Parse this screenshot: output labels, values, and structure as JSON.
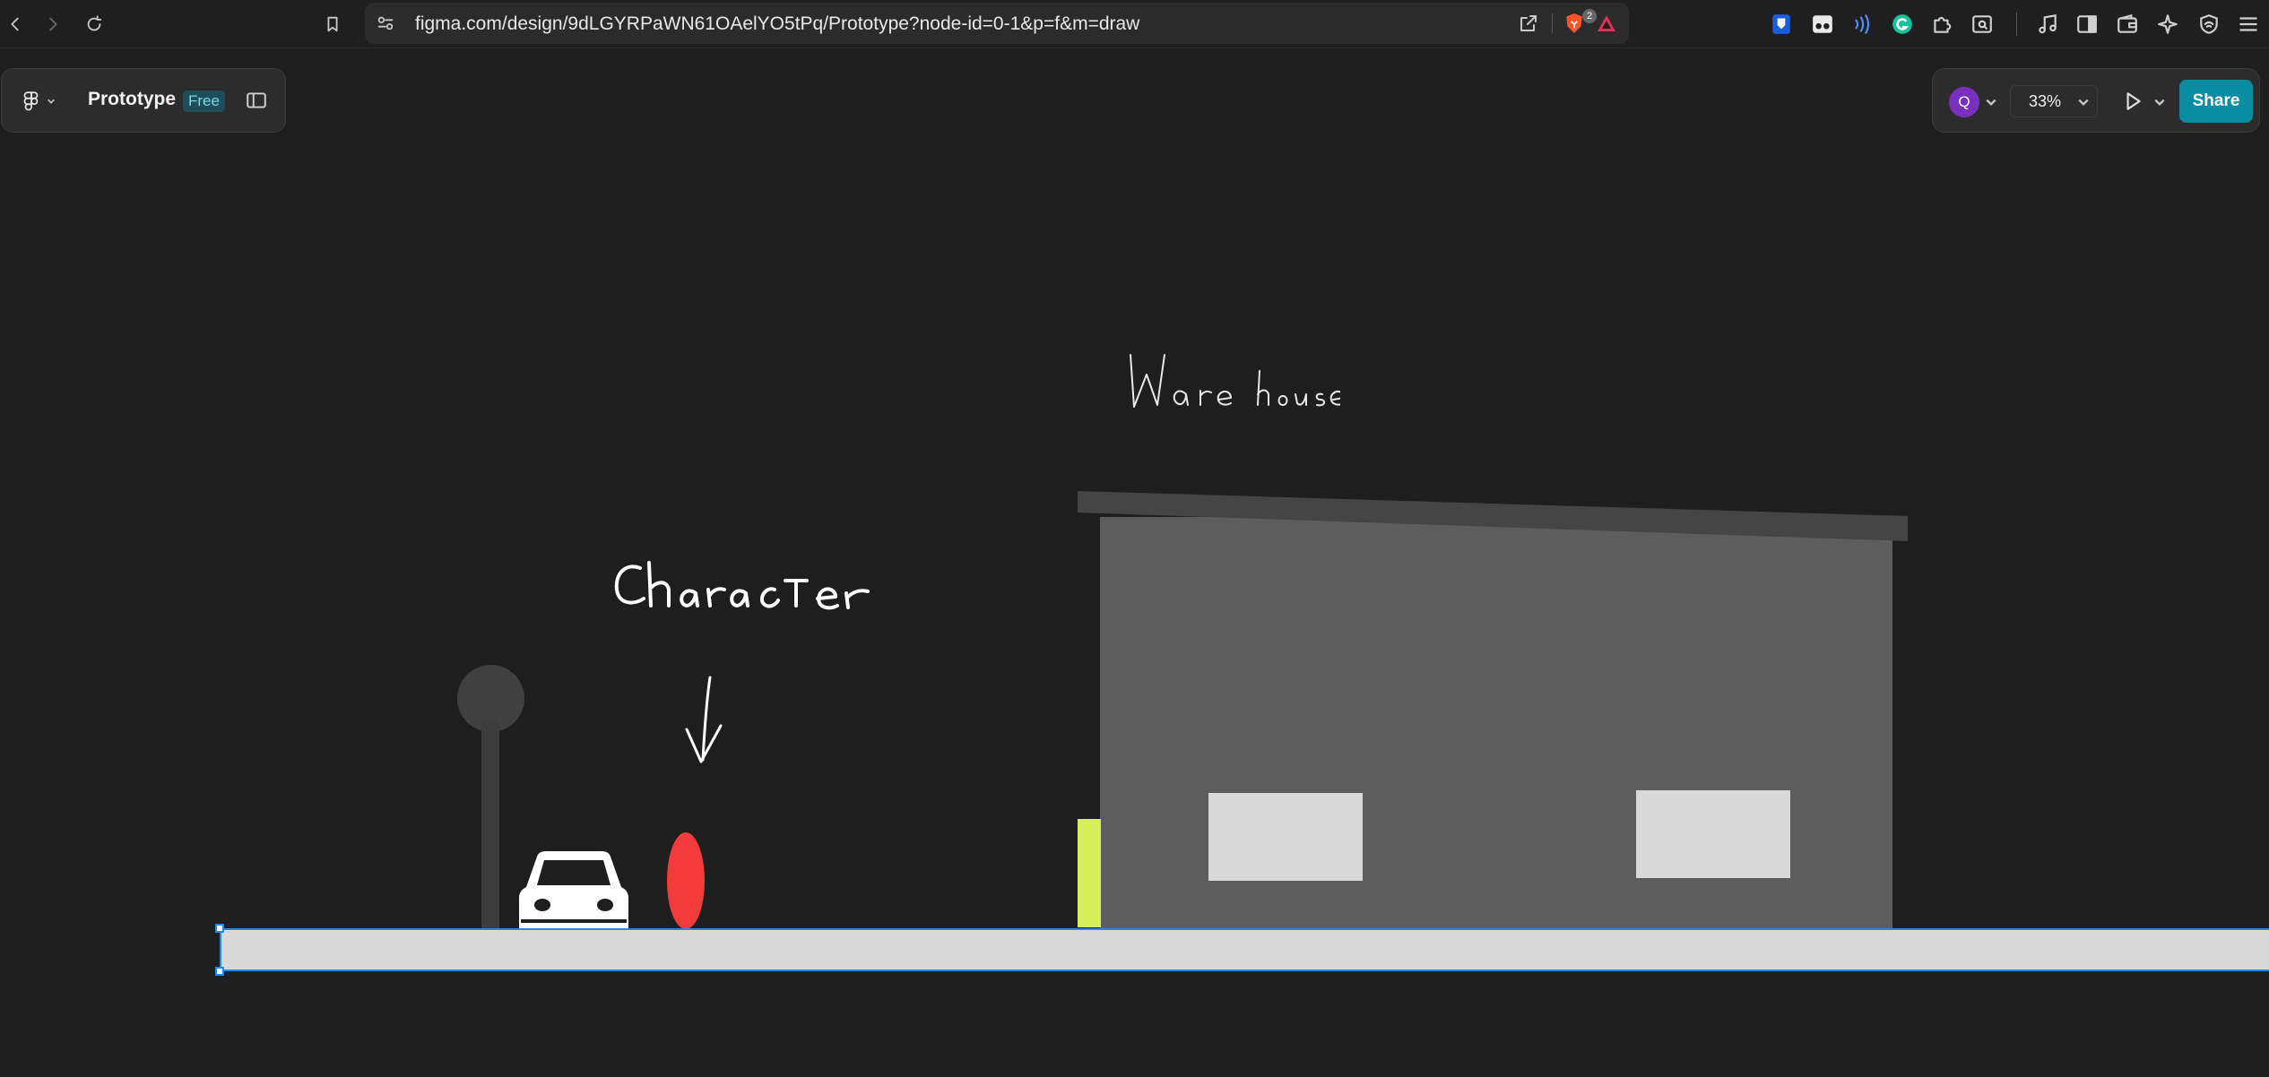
{
  "browser": {
    "url": "figma.com/design/9dLGYRPaWN61OAelYO5tPq/Prototype?node-id=0-1&p=f&m=draw",
    "brave_badge_count": "2",
    "icons": [
      "back-icon",
      "forward-icon",
      "reload-icon",
      "bookmark-icon",
      "site-settings-icon",
      "share-page-icon",
      "brave-shields-icon",
      "brave-rewards-icon",
      "bitwarden-icon",
      "extension-glasses-icon",
      "extension-wave-icon",
      "extension-grammarly-icon",
      "extensions-puzzle-icon",
      "reader-mode-icon",
      "media-playlist-icon",
      "sidebar-icon",
      "wallet-icon",
      "leo-ai-icon",
      "vpn-icon",
      "menu-icon"
    ]
  },
  "figma": {
    "file_title": "Prototype",
    "plan_badge": "Free",
    "user_initial": "Q",
    "zoom": "33%",
    "share_label": "Share"
  },
  "canvas": {
    "label_warehouse": "Ware house",
    "label_character": "Character",
    "colors": {
      "background": "#1e1e1e",
      "ground": "#d9d9d9",
      "selection": "#1a8cff",
      "character": "#f43b3b",
      "warehouse": "#5d5d5d",
      "roof": "#454545",
      "window": "#d9d9d9",
      "sign": "#d6ef5a",
      "lamp": "#404040",
      "car": "#ffffff"
    }
  }
}
